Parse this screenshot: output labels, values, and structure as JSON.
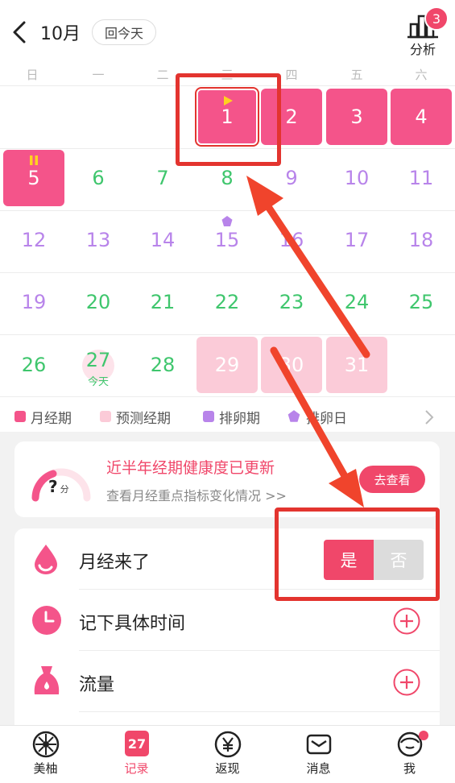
{
  "header": {
    "month": "10月",
    "today_button": "回今天",
    "analysis_label": "分析",
    "badge_count": "3"
  },
  "weekdays": [
    "日",
    "一",
    "二",
    "三",
    "四",
    "五",
    "六"
  ],
  "calendar": {
    "row1": [
      "1",
      "2",
      "3",
      "4"
    ],
    "row2": [
      "5",
      "6",
      "7",
      "8",
      "9",
      "10",
      "11"
    ],
    "row3": [
      "12",
      "13",
      "14",
      "15",
      "16",
      "17",
      "18"
    ],
    "row4": [
      "19",
      "20",
      "21",
      "22",
      "23",
      "24",
      "25"
    ],
    "row5": [
      "26",
      "27",
      "28",
      "29",
      "30",
      "31"
    ],
    "today_label": "今天"
  },
  "legend": [
    "月经期",
    "预测经期",
    "排卵期",
    "排卵日"
  ],
  "health_card": {
    "score": "?",
    "score_unit": "分",
    "title": "近半年经期健康度已更新",
    "subtitle": "查看月经重点指标变化情况 >>",
    "button": "去查看"
  },
  "records": {
    "period_came": "月经来了",
    "yes": "是",
    "no": "否",
    "record_time": "记下具体时间",
    "flow": "流量"
  },
  "tabs": [
    "美柚",
    "记录",
    "返现",
    "消息",
    "我"
  ],
  "tab_calendar_day": "27",
  "colors": {
    "accent": "#f0476a",
    "period": "#f4548a",
    "predict": "#fbcbd8",
    "green": "#3fc66d",
    "purple": "#b884ea"
  }
}
